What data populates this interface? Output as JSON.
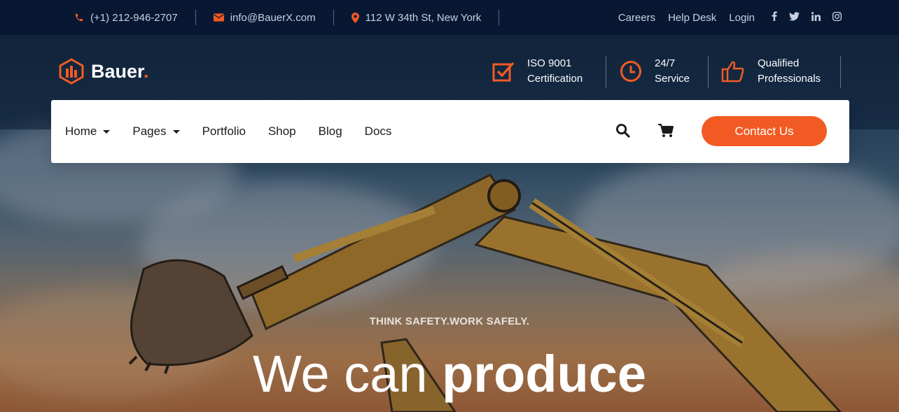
{
  "topbar": {
    "phone": "(+1) 212-946-2707",
    "email": "info@BauerX.com",
    "address": "112 W 34th St, New York",
    "links": [
      "Careers",
      "Help Desk",
      "Login"
    ],
    "social_icons": [
      "facebook-icon",
      "twitter-icon",
      "linkedin-icon",
      "instagram-icon"
    ]
  },
  "brand": {
    "name": "Bauer",
    "dot": "."
  },
  "features": [
    {
      "icon": "checkbox-icon",
      "line1": "ISO 9001",
      "line2": "Certification"
    },
    {
      "icon": "clock-icon",
      "line1": "24/7",
      "line2": "Service"
    },
    {
      "icon": "thumbs-up-icon",
      "line1": "Qualified",
      "line2": "Professionals"
    }
  ],
  "nav": {
    "items": [
      {
        "label": "Home",
        "dropdown": true
      },
      {
        "label": "Pages",
        "dropdown": true
      },
      {
        "label": "Portfolio",
        "dropdown": false
      },
      {
        "label": "Shop",
        "dropdown": false
      },
      {
        "label": "Blog",
        "dropdown": false
      },
      {
        "label": "Docs",
        "dropdown": false
      }
    ],
    "contact_label": "Contact Us"
  },
  "hero": {
    "tagline": "THINK SAFETY.WORK SAFELY.",
    "headline_light": "We can ",
    "headline_bold": "produce"
  },
  "colors": {
    "accent": "#f25a23",
    "topbar_bg": "#081833"
  }
}
